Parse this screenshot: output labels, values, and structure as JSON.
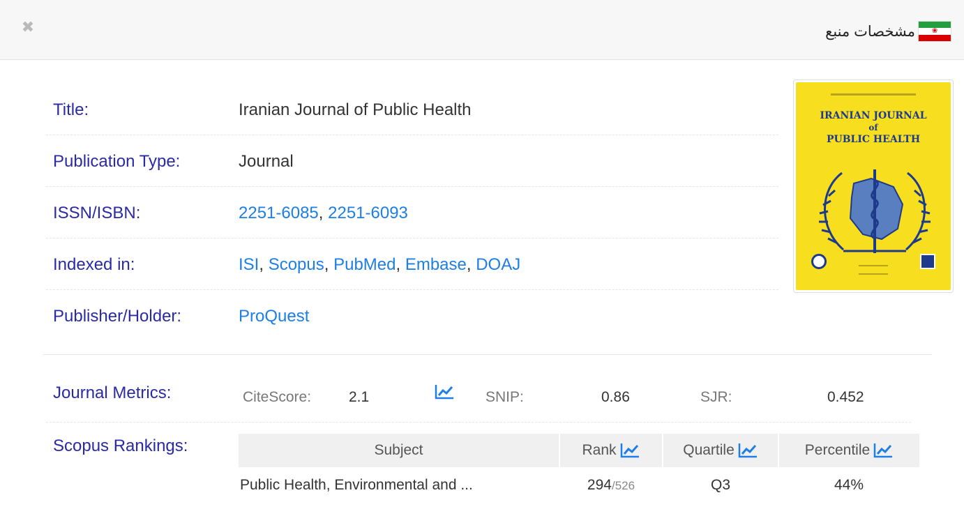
{
  "header": {
    "title": "مشخصات منبع",
    "close_icon": "close-icon",
    "flag_icon": "iran-flag-icon"
  },
  "details": [
    {
      "label": "Title:",
      "value": "Iranian Journal of Public Health"
    },
    {
      "label": "Publication Type:",
      "value": "Journal"
    },
    {
      "label": "ISSN/ISBN:",
      "links": [
        "2251-6085",
        "2251-6093"
      ]
    },
    {
      "label": "Indexed in:",
      "links": [
        "ISI",
        "Scopus",
        "PubMed",
        "Embase",
        "DOAJ"
      ]
    },
    {
      "label": "Publisher/Holder:",
      "links": [
        "ProQuest"
      ]
    }
  ],
  "cover": {
    "title_line1": "IRANIAN JOURNAL",
    "title_line2": "of",
    "title_line3": "PUBLIC HEALTH"
  },
  "metrics": {
    "label": "Journal Metrics:",
    "citescore_label": "CiteScore:",
    "citescore_value": "2.1",
    "snip_label": "SNIP:",
    "snip_value": "0.86",
    "sjr_label": "SJR:",
    "sjr_value": "0.452",
    "trend_icon": "trend-chart-icon"
  },
  "rankings": {
    "label": "Scopus Rankings:",
    "headers": {
      "subject": "Subject",
      "rank": "Rank",
      "quartile": "Quartile",
      "percentile": "Percentile"
    },
    "rows": [
      {
        "subject": "Public Health, Environmental and ...",
        "rank": "294",
        "rank_of": "/526",
        "quartile": "Q3",
        "percentile": "44%"
      }
    ]
  },
  "colors": {
    "label_blue": "#2a2aa6",
    "link_blue": "#1e7ee8",
    "cover_yellow": "#f7de1f"
  }
}
